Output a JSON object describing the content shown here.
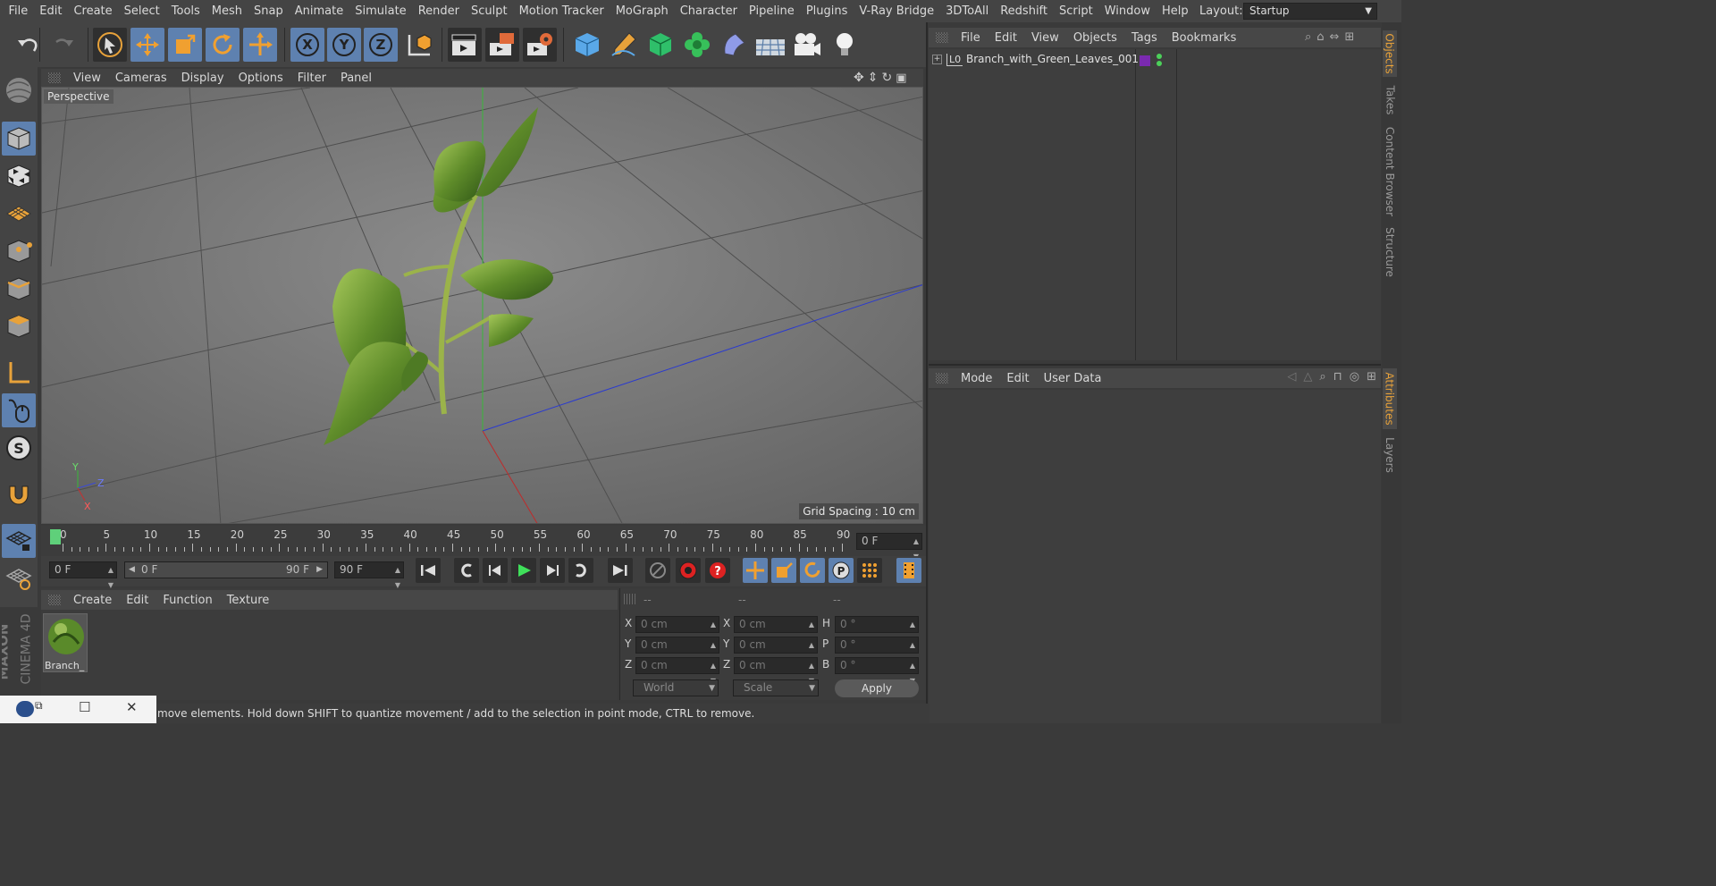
{
  "menu": [
    "File",
    "Edit",
    "Create",
    "Select",
    "Tools",
    "Mesh",
    "Snap",
    "Animate",
    "Simulate",
    "Render",
    "Sculpt",
    "Motion Tracker",
    "MoGraph",
    "Character",
    "Pipeline",
    "Plugins",
    "V-Ray Bridge",
    "3DToAll",
    "Redshift",
    "Script",
    "Window",
    "Help"
  ],
  "layout": {
    "label": "Layout:",
    "value": "Startup"
  },
  "viewport": {
    "menu": [
      "View",
      "Cameras",
      "Display",
      "Options",
      "Filter",
      "Panel"
    ],
    "camera_label": "Perspective",
    "grid_spacing": "Grid Spacing : 10 cm",
    "axis_labels": {
      "y": "Y",
      "z": "Z",
      "x": "X"
    }
  },
  "objects_panel": {
    "menu": [
      "File",
      "Edit",
      "View",
      "Objects",
      "Tags",
      "Bookmarks"
    ],
    "items": [
      {
        "name": "Branch_with_Green_Leaves_001",
        "layer": "L0"
      }
    ]
  },
  "attributes_panel": {
    "menu": [
      "Mode",
      "Edit",
      "User Data"
    ]
  },
  "right_tabs": [
    "Objects",
    "Takes",
    "Content Browser",
    "Structure"
  ],
  "right_tabs_lower": [
    "Attributes",
    "Layers"
  ],
  "timeline": {
    "labels": [
      "0",
      "5",
      "10",
      "15",
      "20",
      "25",
      "30",
      "35",
      "40",
      "45",
      "50",
      "55",
      "60",
      "65",
      "70",
      "75",
      "80",
      "85",
      "90"
    ],
    "current_frame": "0 F"
  },
  "playback": {
    "start": "0 F",
    "range_start": "0 F",
    "range_end": "90 F",
    "end": "90 F"
  },
  "material_panel": {
    "menu": [
      "Create",
      "Edit",
      "Function",
      "Texture"
    ],
    "material_name": "Branch_"
  },
  "coordinates": {
    "header": [
      "--",
      "--",
      "--"
    ],
    "rows": [
      {
        "l1": "X",
        "v1": "0 cm",
        "l2": "X",
        "v2": "0 cm",
        "l3": "H",
        "v3": "0 °"
      },
      {
        "l1": "Y",
        "v1": "0 cm",
        "l2": "Y",
        "v2": "0 cm",
        "l3": "P",
        "v3": "0 °"
      },
      {
        "l1": "Z",
        "v1": "0 cm",
        "l2": "Z",
        "v2": "0 cm",
        "l3": "B",
        "v3": "0 °"
      }
    ],
    "mode_select": "World",
    "scale_select": "Scale",
    "apply": "Apply"
  },
  "status": "move elements. Hold down SHIFT to quantize movement / add to the selection in point mode, CTRL to remove.",
  "brand": {
    "line1": "MAXON",
    "line2": "CINEMA 4D"
  },
  "colors": {
    "accent_blue": "#5e81b0",
    "orange": "#e8a23a",
    "green_leaf": "#6a9a2c"
  }
}
